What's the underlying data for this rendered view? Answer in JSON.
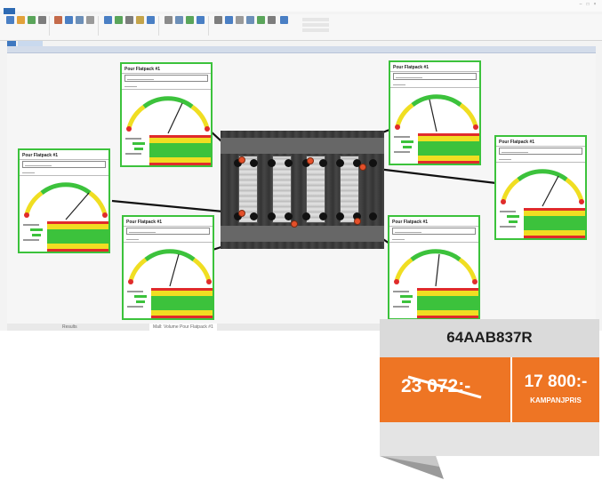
{
  "app": {
    "title": "",
    "file_tab": "",
    "ribbon_tabs": [
      "",
      "",
      "",
      ""
    ],
    "bottom_tabs": [
      "Results",
      "Mall: Volume Pour Flatpack #1"
    ]
  },
  "tools": [
    {
      "name": "Pour Flatpack #1"
    },
    {
      "name": "Pour Flatpack #1"
    },
    {
      "name": "Pour Flatpack #1"
    },
    {
      "name": "Pour Flatpack #1"
    },
    {
      "name": "Pour Flatpack #1"
    },
    {
      "name": "Pour Flatpack #1"
    }
  ],
  "colors": {
    "tool_border": "#3cc23c",
    "band_red": "#e02b2b",
    "band_yellow": "#f0de22",
    "band_green": "#3cc23c",
    "marker": "#e5502a",
    "tag_orange": "#ee7524",
    "tag_gray": "#dadada"
  },
  "price_tag": {
    "model": "64AAB837R",
    "old_price": "23 072:-",
    "new_price": "17 800:-",
    "new_price_label": "KAMPANJPRIS"
  }
}
